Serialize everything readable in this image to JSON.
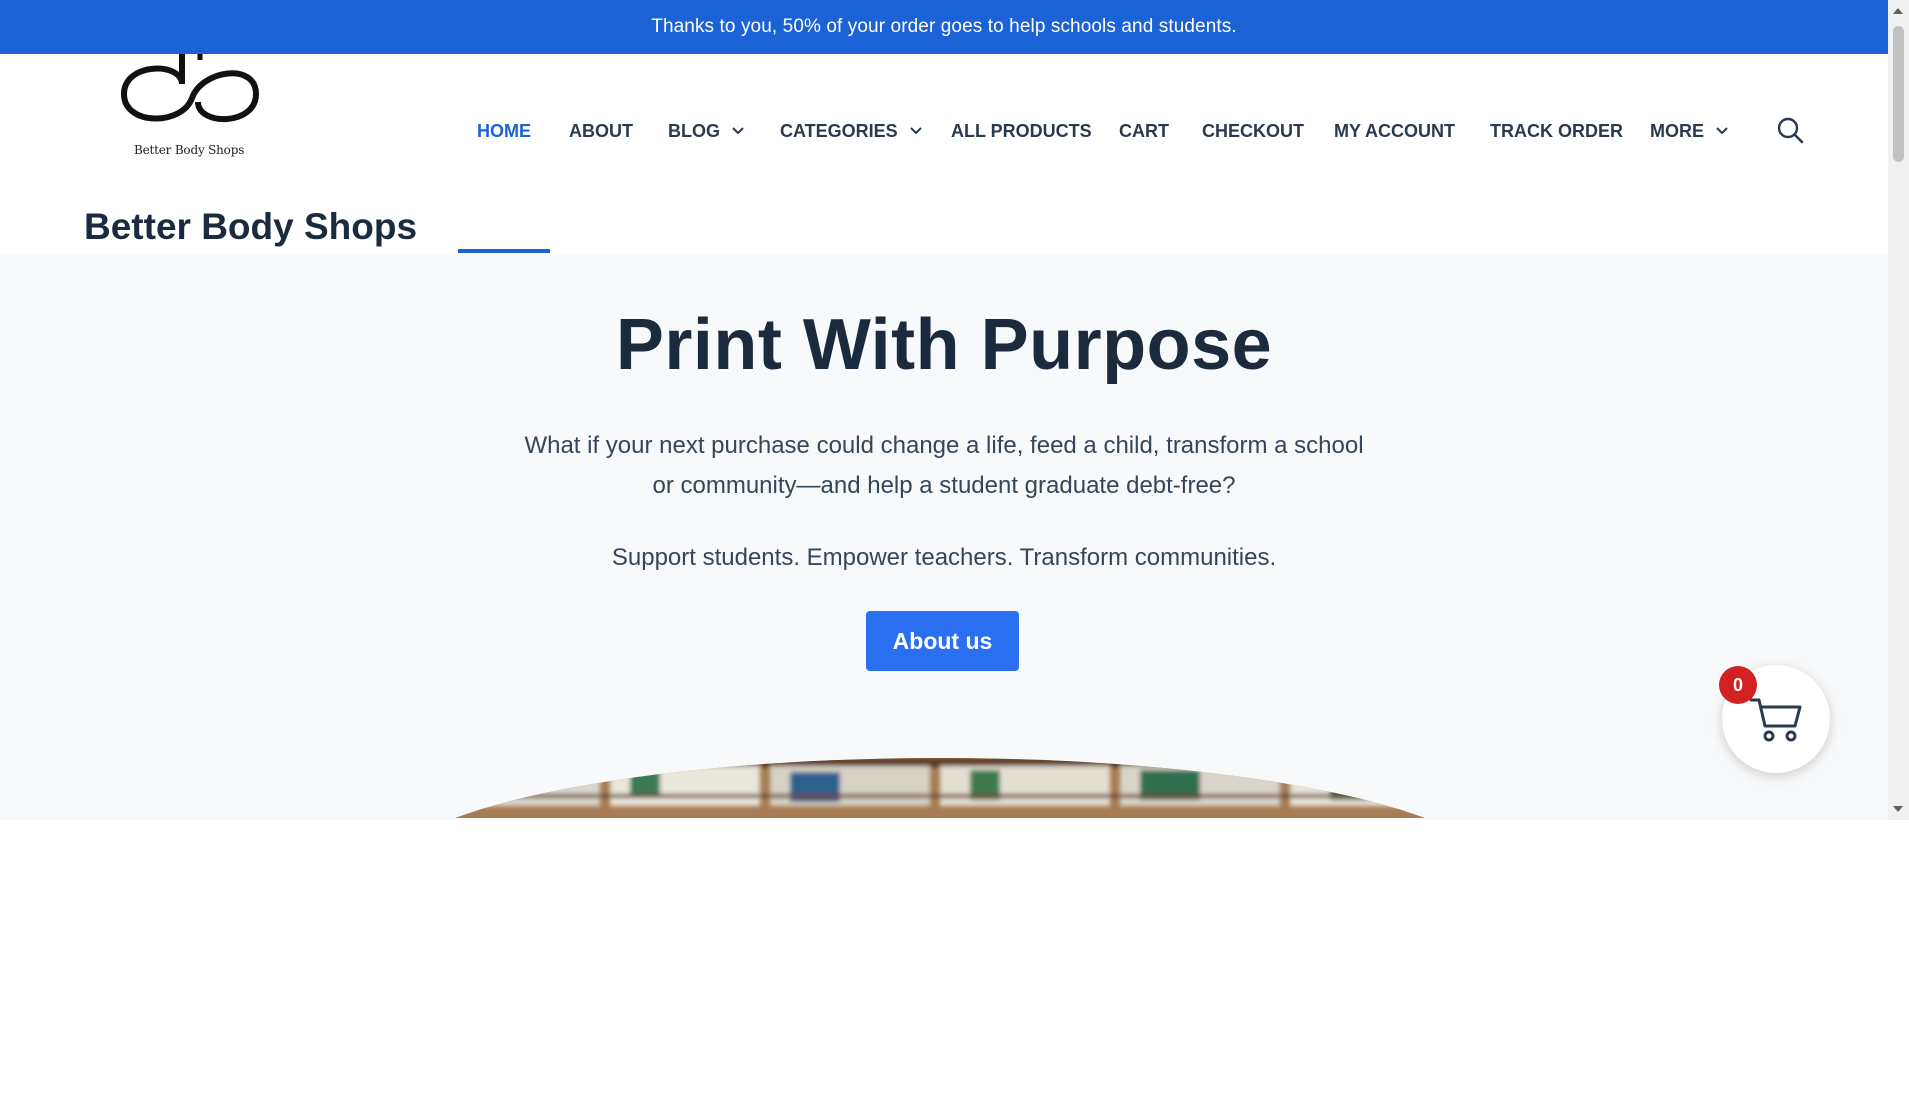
{
  "colors": {
    "accent": "#1a62d6",
    "button": "#2a6ff0",
    "badge": "#d32020"
  },
  "announcement": "Thanks to you, 50% of your order goes to help schools and students.",
  "logo": {
    "caption": "Better Body Shops"
  },
  "nav": {
    "items": [
      {
        "label": "HOME",
        "active": true
      },
      {
        "label": "ABOUT"
      },
      {
        "label": "BLOG",
        "dropdown": true
      },
      {
        "label": "CATEGORIES",
        "dropdown": true
      },
      {
        "label": "ALL PRODUCTS"
      },
      {
        "label": "CART"
      },
      {
        "label": "CHECKOUT"
      },
      {
        "label": "MY ACCOUNT"
      },
      {
        "label": "TRACK ORDER"
      },
      {
        "label": "MORE",
        "dropdown": true
      }
    ],
    "search_icon": "search-icon"
  },
  "site_title": "Better Body Shops",
  "hero": {
    "title": "Print With Purpose",
    "text": "What if your next purchase could change a life, feed a child, transform a school or community—and help a student graduate debt-free?",
    "subtext": "Support students. Empower teachers. Transform communities.",
    "button_label": "About us"
  },
  "cart": {
    "count": "0",
    "icon": "cart-icon"
  }
}
